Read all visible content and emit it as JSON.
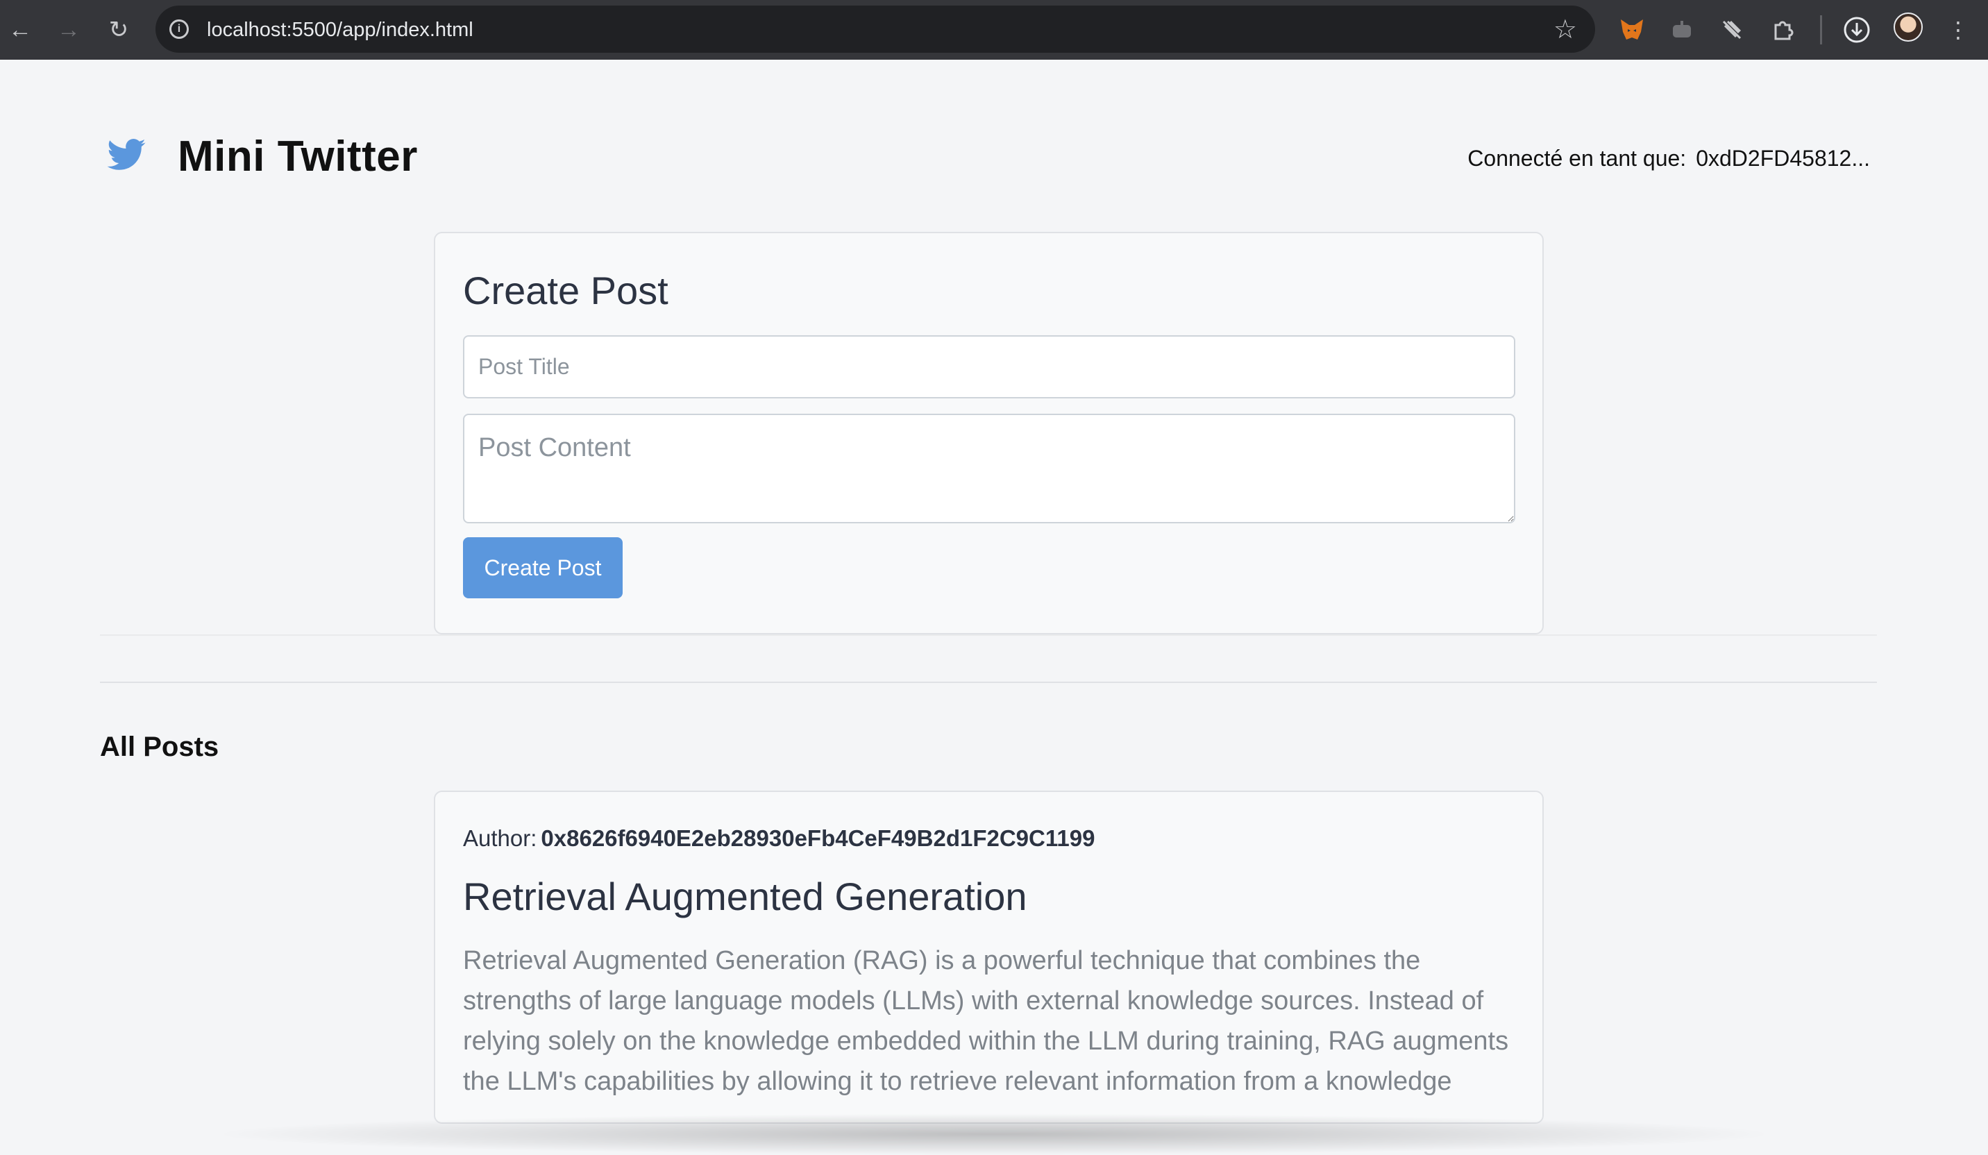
{
  "browser": {
    "url": "localhost:5500/app/index.html"
  },
  "header": {
    "app_title": "Mini Twitter",
    "connected_label": "Connecté en tant que:",
    "connected_address": "0xdD2FD45812..."
  },
  "create_post": {
    "title": "Create Post",
    "title_placeholder": "Post Title",
    "content_placeholder": "Post Content",
    "button_label": "Create Post"
  },
  "posts_section": {
    "title": "All Posts",
    "posts": [
      {
        "author_label": "Author:",
        "author": "0x8626f6940E2eb28930eFb4CeF49B2d1F2C9C1199",
        "title": "Retrieval Augmented Generation",
        "body": "Retrieval Augmented Generation (RAG) is a powerful technique that combines the strengths of large language models (LLMs) with external knowledge sources. Instead of relying solely on the knowledge embedded within the LLM during training, RAG augments the LLM's capabilities by allowing it to retrieve relevant information from a knowledge"
      }
    ]
  },
  "colors": {
    "accent": "#5b97dd",
    "logo": "#5b97dd",
    "page_bg": "#f4f5f7",
    "card_bg": "#f8f9fa"
  }
}
